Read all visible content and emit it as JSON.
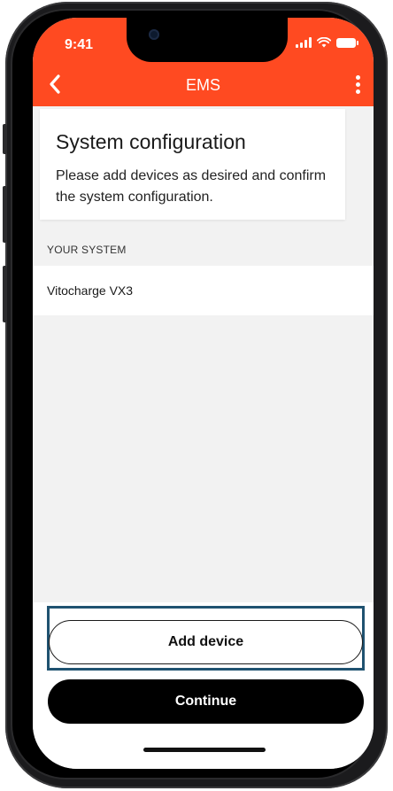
{
  "status_bar": {
    "time": "9:41"
  },
  "header": {
    "title": "EMS"
  },
  "intro": {
    "heading": "System configuration",
    "description": "Please add devices as desired and confirm the system configuration."
  },
  "section": {
    "label": "YOUR SYSTEM"
  },
  "devices": [
    {
      "name": "Vitocharge VX3"
    }
  ],
  "actions": {
    "add_device": "Add device",
    "continue": "Continue"
  },
  "colors": {
    "accent": "#ff4a21",
    "primary_button": "#000000",
    "highlight_border": "#1f5270"
  }
}
